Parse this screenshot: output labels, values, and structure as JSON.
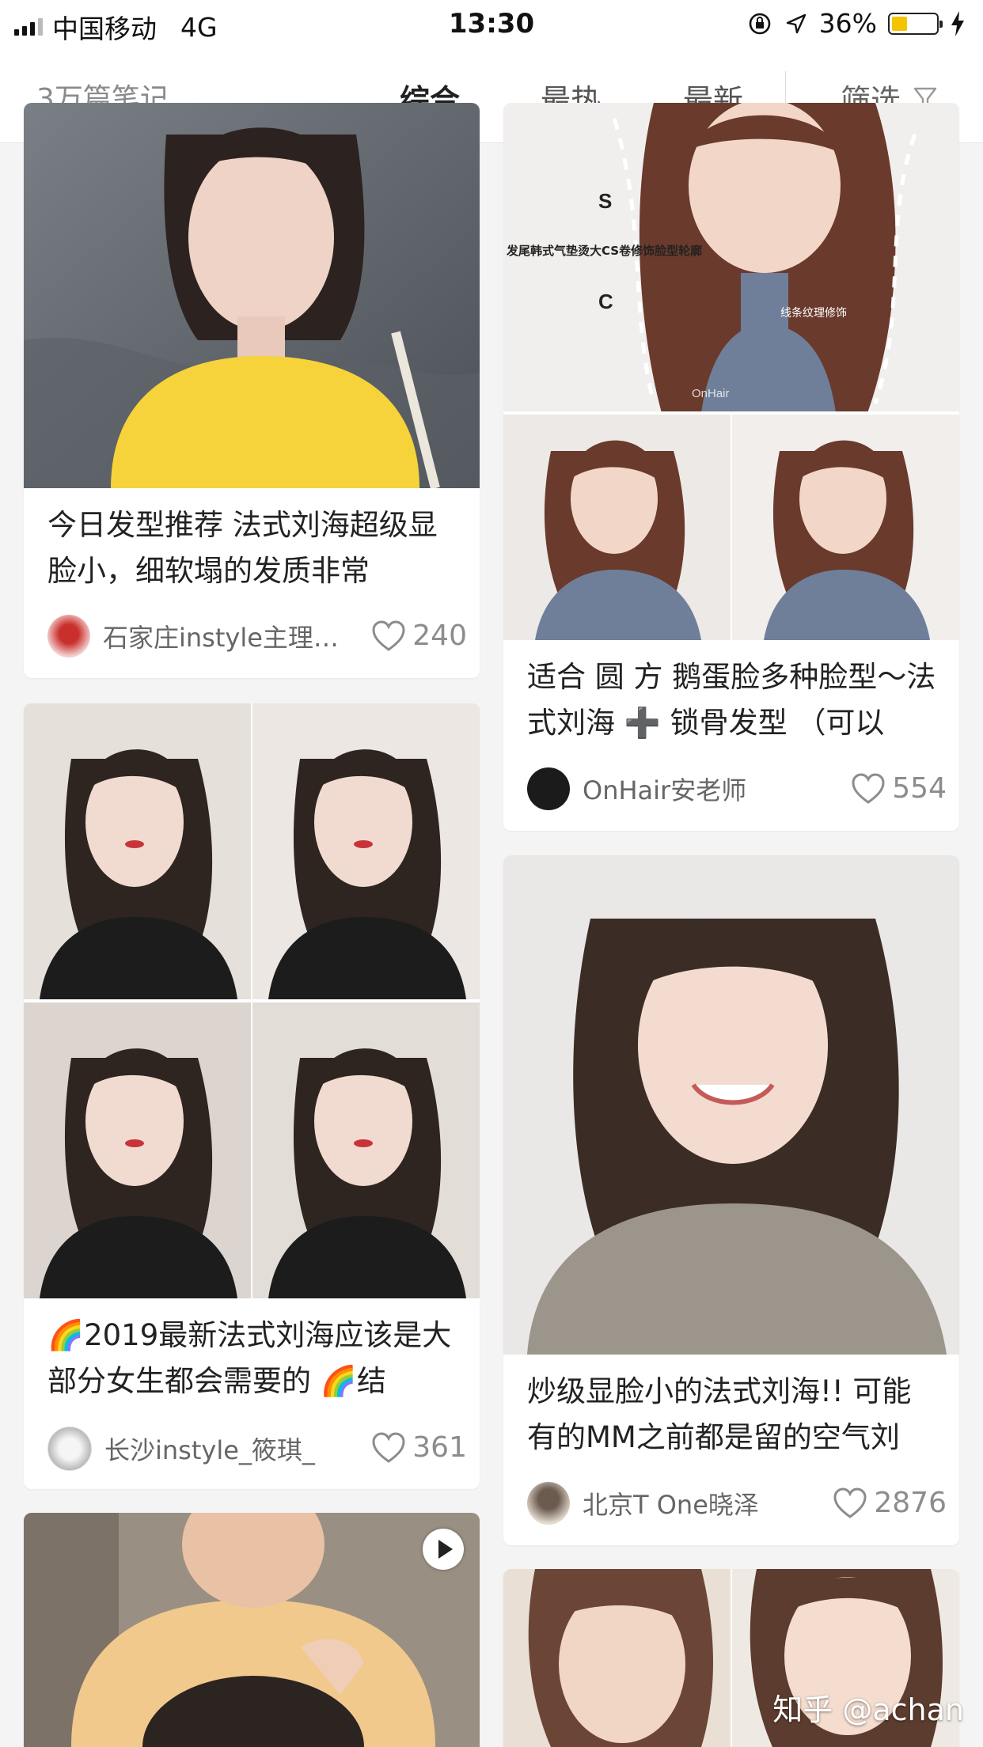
{
  "status": {
    "carrier": "中国移动",
    "network": "4G",
    "time": "13:30",
    "battery_percent_text": "36%",
    "battery_level": 0.36,
    "battery_color": "#f5c400",
    "icons": [
      "orientation-lock-icon",
      "location-arrow-icon",
      "charging-bolt-icon"
    ]
  },
  "header": {
    "note_count": "3万篇笔记",
    "tabs": [
      {
        "label": "综合",
        "active": true
      },
      {
        "label": "最热",
        "active": false
      },
      {
        "label": "最新",
        "active": false
      }
    ],
    "filter_label": "筛选"
  },
  "feed": {
    "left": [
      {
        "title": "今日发型推荐 法式刘海超级显脸小，细软塌的发质非常",
        "author": "石家庄instyle主理…",
        "likes": "240"
      },
      {
        "title": "🌈2019最新法式刘海应该是大部分女生都会需要的 🌈结",
        "author": "长沙instyle_筱琪_",
        "likes": "361"
      },
      {
        "is_video": true
      }
    ],
    "right": [
      {
        "image_text": {
          "s": "S",
          "c": "C",
          "annotation": "发尾韩式气垫烫大CS卷修饰脸型轮廓",
          "texture": "线条纹理修饰",
          "watermark": "OnHair"
        },
        "title": "适合 圆 方 鹅蛋脸多种脸型～法式刘海 ➕ 锁骨发型 （可以",
        "author": "OnHair安老师",
        "likes": "554"
      },
      {
        "title": "炒级显脸小的法式刘海!! 可能有的MM之前都是留的空气刘",
        "author": "北京T One晓泽",
        "likes": "2876"
      }
    ]
  },
  "watermark": "知乎 @achan"
}
